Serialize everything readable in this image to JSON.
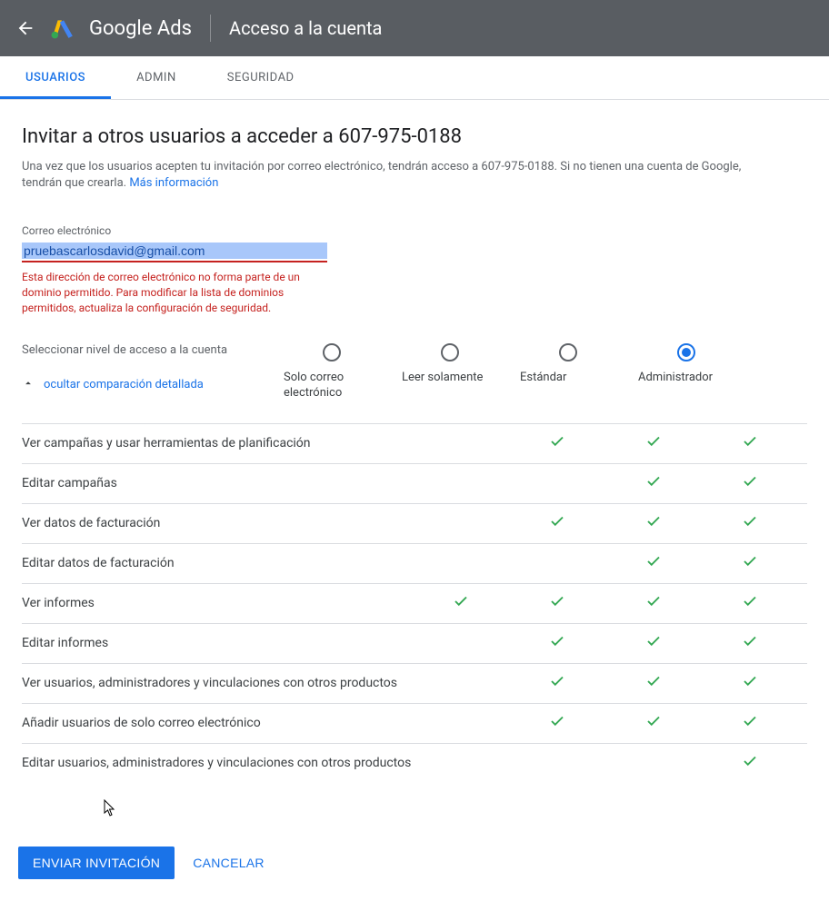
{
  "header": {
    "product": "Google Ads",
    "title": "Acceso a la cuenta"
  },
  "tabs": {
    "users": "USUARIOS",
    "admin": "ADMIN",
    "security": "SEGURIDAD"
  },
  "page": {
    "heading": "Invitar a otros usuarios a acceder a 607-975-0188",
    "description_prefix": "Una vez que los usuarios acepten tu invitación por correo electrónico, tendrán acceso a 607-975-0188. Si no tienen una cuenta de Google, tendrán que crearla. ",
    "more_info": "Más información"
  },
  "email_field": {
    "label": "Correo electrónico",
    "value": "pruebascarlosdavid@gmail.com",
    "error": "Esta dirección de correo electrónico no forma parte de un dominio permitido. Para modificar la lista de dominios permitidos, actualiza la configuración de seguridad."
  },
  "access": {
    "label": "Seleccionar nivel de acceso a la cuenta",
    "toggle": "ocultar comparación detallada",
    "options": {
      "email_only": "Solo correo electrónico",
      "read_only": "Leer solamente",
      "standard": "Estándar",
      "admin": "Administrador"
    },
    "selected": "admin"
  },
  "permissions": [
    {
      "label": "Ver campañas y usar herramientas de planificación",
      "cols": [
        false,
        false,
        true,
        true,
        true
      ]
    },
    {
      "label": "Editar campañas",
      "cols": [
        false,
        false,
        false,
        true,
        true
      ]
    },
    {
      "label": "Ver datos de facturación",
      "cols": [
        false,
        false,
        true,
        true,
        true
      ]
    },
    {
      "label": "Editar datos de facturación",
      "cols": [
        false,
        false,
        false,
        true,
        true
      ]
    },
    {
      "label": "Ver informes",
      "cols": [
        false,
        true,
        true,
        true,
        true
      ]
    },
    {
      "label": "Editar informes",
      "cols": [
        false,
        false,
        true,
        true,
        true
      ]
    },
    {
      "label": "Ver usuarios, administradores y vinculaciones con otros productos",
      "cols": [
        false,
        false,
        true,
        true,
        true
      ]
    },
    {
      "label": "Añadir usuarios de solo correo electrónico",
      "cols": [
        false,
        false,
        true,
        true,
        true
      ]
    },
    {
      "label": "Editar usuarios, administradores y vinculaciones con otros productos",
      "cols": [
        false,
        false,
        false,
        false,
        true
      ]
    }
  ],
  "buttons": {
    "send": "ENVIAR INVITACIÓN",
    "cancel": "CANCELAR"
  }
}
